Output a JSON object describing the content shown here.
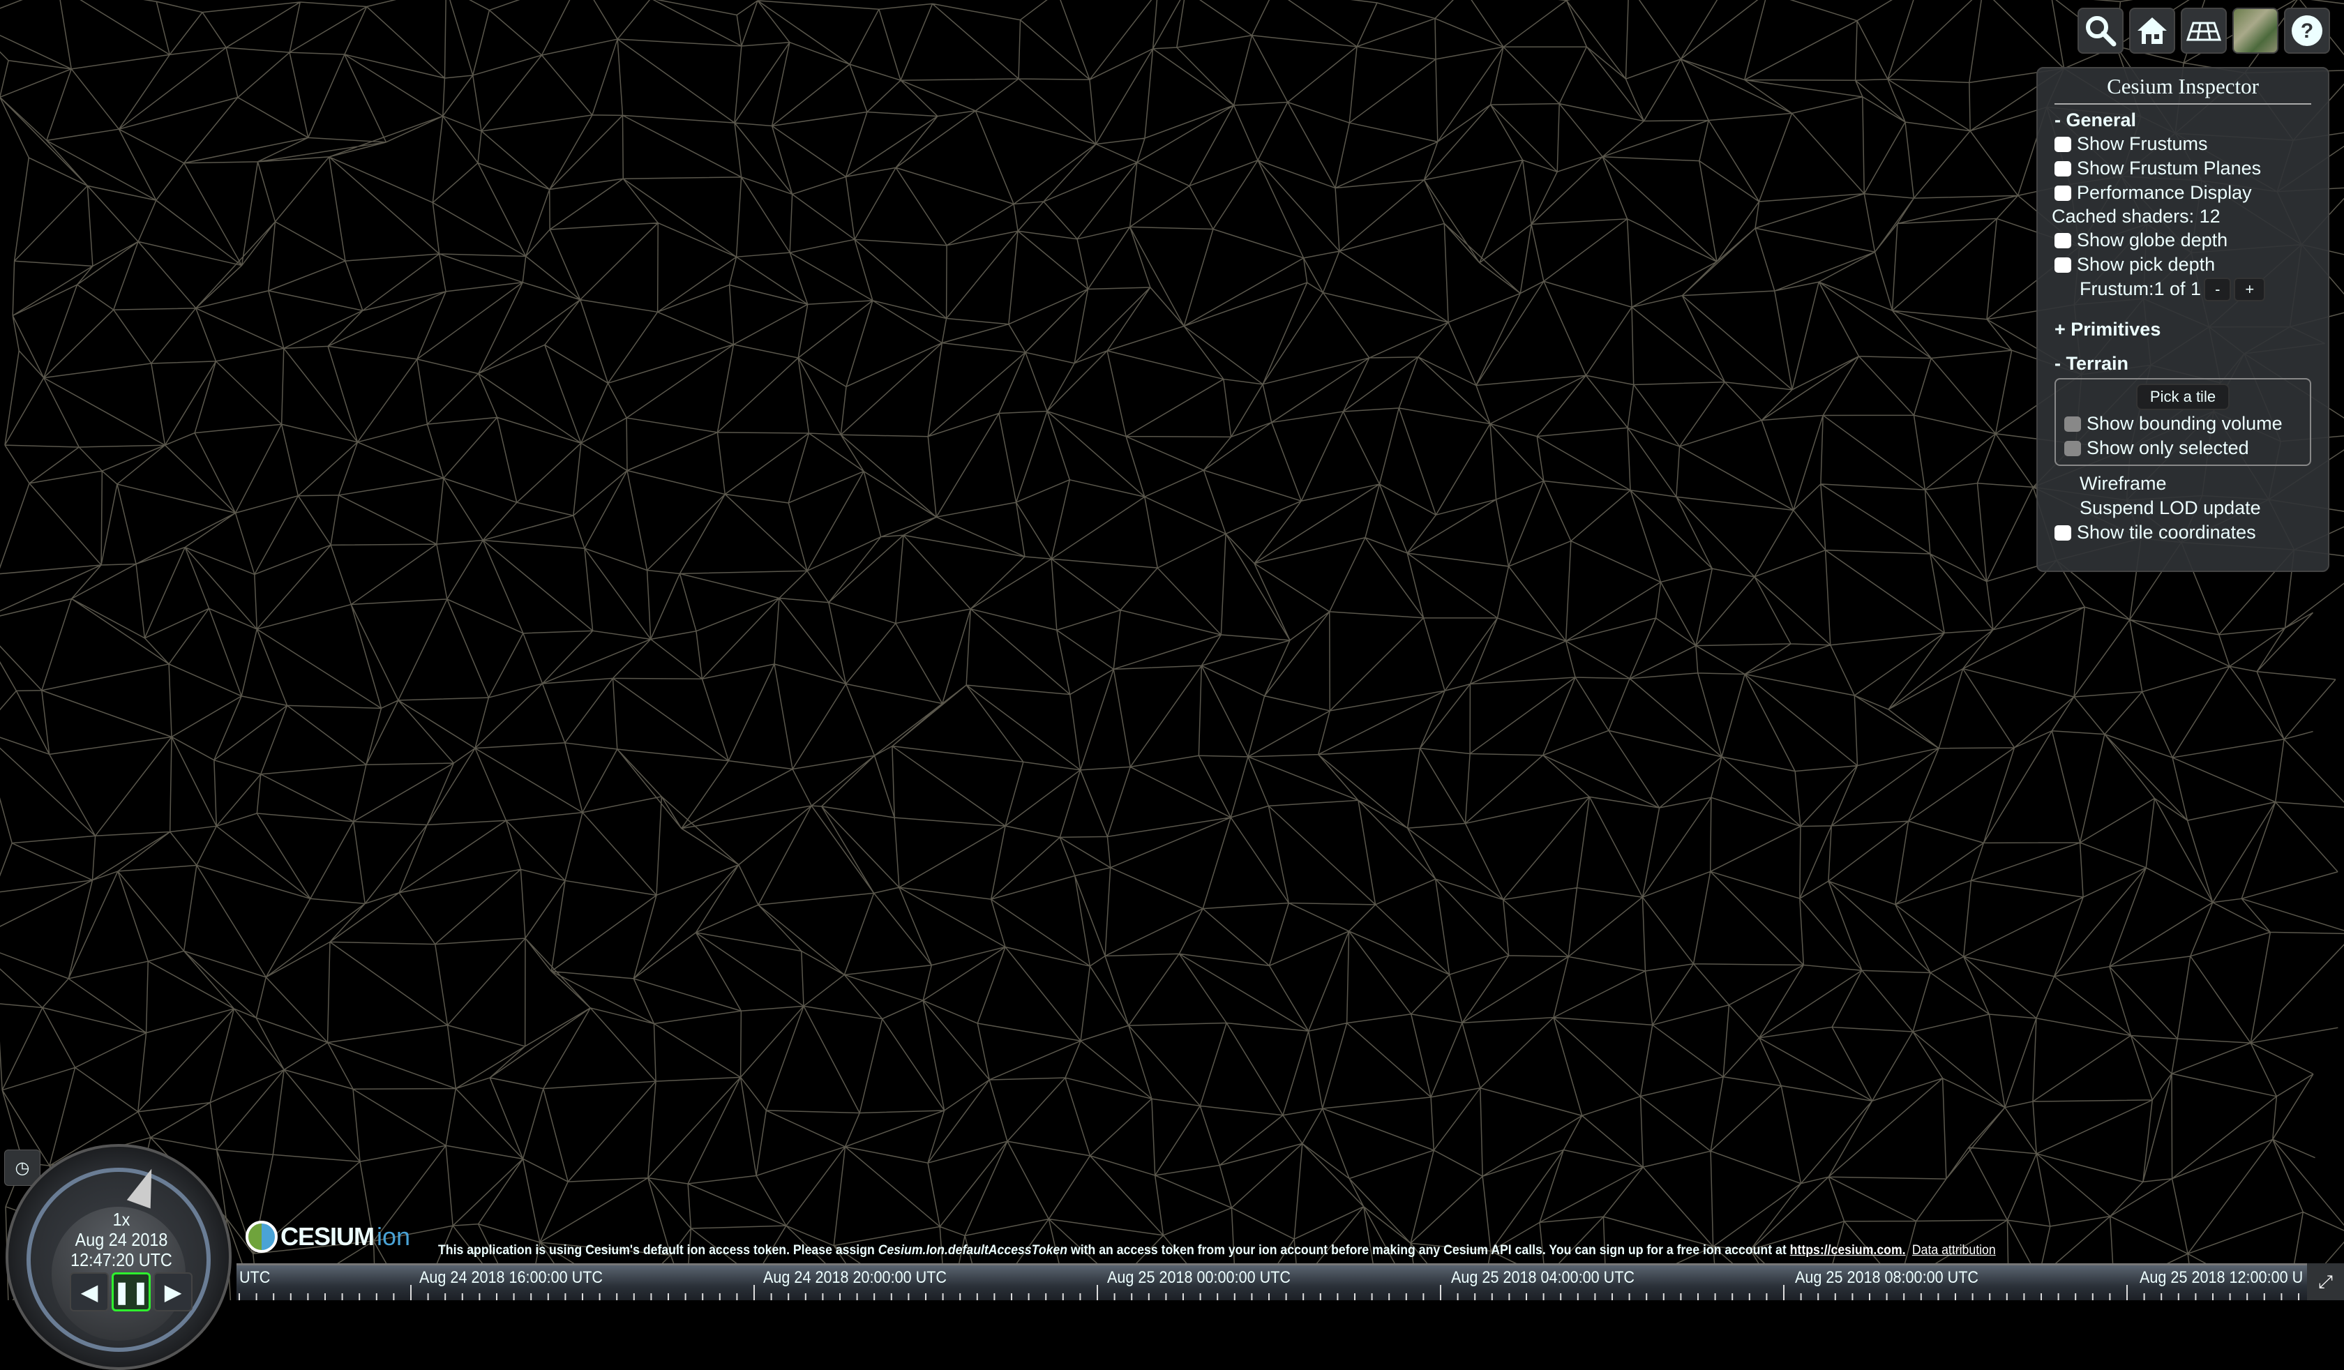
{
  "toolbar": {
    "buttons": [
      {
        "name": "geocoder",
        "icon": "search-icon"
      },
      {
        "name": "home",
        "icon": "home-icon"
      },
      {
        "name": "scene-mode",
        "icon": "columbus-view-icon"
      },
      {
        "name": "base-layer-picker",
        "icon": "imagery-thumbnail"
      },
      {
        "name": "navigation-help",
        "icon": "help-icon"
      }
    ]
  },
  "inspector": {
    "title": "Cesium Inspector",
    "general": {
      "header": "- General",
      "show_frustums": "Show Frustums",
      "show_frustum_planes": "Show Frustum Planes",
      "performance_display": "Performance Display",
      "cached_shaders": "Cached shaders: 12",
      "show_globe_depth": "Show globe depth",
      "show_pick_depth": "Show pick depth",
      "frustum": "Frustum:1 of 1",
      "minus": "-",
      "plus": "+"
    },
    "primitives": {
      "header": "+ Primitives"
    },
    "terrain": {
      "header": "- Terrain",
      "pick_tile": "Pick a tile",
      "show_bounding_volume": "Show bounding volume",
      "show_only_selected": "Show only selected",
      "wireframe": "Wireframe",
      "suspend_lod": "Suspend LOD update",
      "show_tile_coordinates": "Show tile coordinates"
    }
  },
  "animation": {
    "speed": "1x",
    "date": "Aug 24 2018",
    "time": "12:47:20 UTC",
    "state": "playing"
  },
  "logo": {
    "brand": "CESIUM",
    "product": "ion"
  },
  "credits": {
    "message_pre": "This application is using Cesium's default ion access token. Please assign ",
    "token_name": "Cesium.Ion.defaultAccessToken",
    "message_post": " with an access token from your ion account before making any Cesium API calls. You can sign up for a free ion account at ",
    "link": "https://cesium.com.",
    "attribution": "Data attribution"
  },
  "timeline": {
    "labels": [
      "UTC",
      "Aug 24 2018 16:00:00 UTC",
      "Aug 24 2018 20:00:00 UTC",
      "Aug 25 2018 00:00:00 UTC",
      "Aug 25 2018 04:00:00 UTC",
      "Aug 25 2018 08:00:00 UTC",
      "Aug 25 2018 12:00:00 U"
    ]
  },
  "colors": {
    "panel": "#303336",
    "wire": "#c8c0a8",
    "play_active": "#2ef22e",
    "ion_blue": "#4aa3d6"
  }
}
